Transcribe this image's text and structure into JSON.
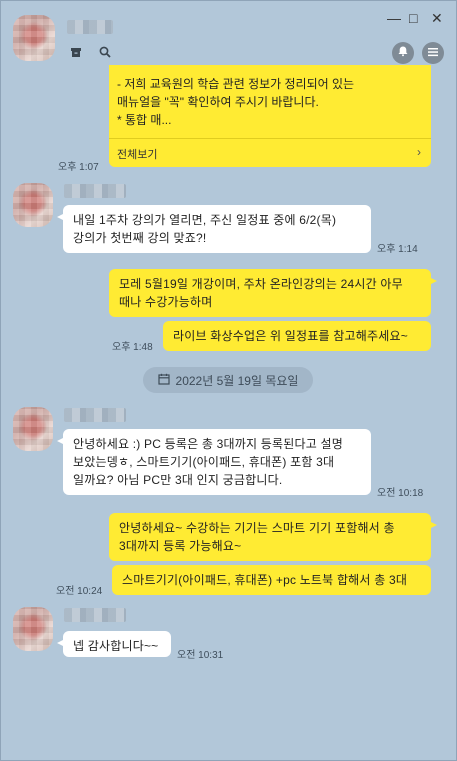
{
  "header": {
    "icons": [
      "archive-icon",
      "search-icon",
      "bell-icon",
      "menu-icon"
    ],
    "window_controls": {
      "minimize": "—",
      "maximize": "□",
      "close": "✕"
    }
  },
  "notice": {
    "text": "- 저희 교육원의 학습 관련 정보가 정리되어 있는\n매뉴얼을 \"꼭\" 확인하여 주시기 바랍니다.\n* 통합 매...",
    "more_label": "전체보기",
    "time": "오후 1:07"
  },
  "messages": [
    {
      "sender": "other",
      "text": "내일 1주차 강의가 열리면, 주신 일정표 중에 6/2(목)\n강의가 첫번째 강의 맞죠?!",
      "time": "오후 1:14"
    },
    {
      "sender": "me",
      "text": "모레 5월19일 개강이며, 주차 온라인강의는 24시간 아무\n때나 수강가능하며",
      "time": ""
    },
    {
      "sender": "me",
      "text": "라이브 화상수업은 위 일정표를 참고해주세요~",
      "time": "오후 1:48"
    },
    {
      "sender": "other",
      "text": "안녕하세요 :) PC 등록은 총 3대까지 등록된다고 설명\n보았는뎅ㅎ, 스마트기기(아이패드, 휴대폰) 포함 3대\n일까요? 아님 PC만 3대 인지 궁금합니다.",
      "time": "오전 10:18"
    },
    {
      "sender": "me",
      "text": "안녕하세요~ 수강하는 기기는 스마트 기기 포함해서 총\n3대까지 등록 가능해요~",
      "time": ""
    },
    {
      "sender": "me",
      "text": "스마트기기(아이패드, 휴대폰) +pc 노트북 합해서 총 3대",
      "time": "오전 10:24"
    },
    {
      "sender": "other",
      "text": "넵 감사합니다~~",
      "time": "오전 10:31"
    }
  ],
  "date_divider": {
    "icon": "calendar-icon",
    "label": "2022년 5월 19일 목요일"
  },
  "colors": {
    "background": "#b2c7d9",
    "my_bubble": "#ffeb33",
    "other_bubble": "#ffffff",
    "date_pill": "#a2b6c8"
  }
}
